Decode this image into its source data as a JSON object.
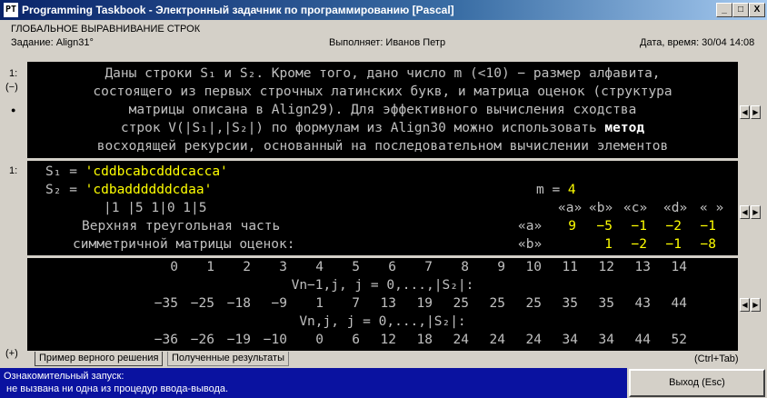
{
  "window": {
    "title": "Programming Taskbook - Электронный задачник по программированию [Pascal]",
    "app_icon": "PT",
    "buttons": [
      "_",
      "□",
      "X"
    ]
  },
  "header": {
    "group": "ГЛОБАЛЬНОЕ ВЫРАВНИВАНИЕ СТРОК",
    "task": "Задание: Align31°",
    "performer": "Выполняет: Иванов Петр",
    "datetime": "Дата, время: 30/04 14:08"
  },
  "task_panel": {
    "side_number": "1:",
    "side_minus": "(−)",
    "lines": [
      "Даны строки S₁ и S₂. Кроме того, дано число m (<10) − размер алфавита,",
      "состоящего из первых строчных латинских букв, и матрица оценок (структура",
      "матрицы описана в Align29). Для эффективного вычисления сходства",
      "строк V(|S₁|,|S₂|) по формулам из Align30 можно использовать ",
      "восходящей рекурсии, основанный на последовательном вычислении элементов"
    ],
    "bold_phrase_1": "метод",
    "bold_phrase_2": "восходящей рекурсии"
  },
  "input_panel": {
    "side_number": "1:",
    "s1_label": "S₁ = ",
    "s1_value": "'cddbcabcdddcacca'",
    "s2_label": "S₂ = ",
    "s2_value": "'cdbaddddddcdaa'",
    "m_label": "m = ",
    "m_value": "4",
    "separator_row": "|1   |5  1|0  1|5",
    "alphabet_header": [
      "«a»",
      "«b»",
      "«c»",
      "«d»",
      "« »"
    ],
    "matrix_label_1": "Верхняя треугольная часть",
    "matrix_label_2": "симметричной матрицы оценок:",
    "matrix_rows": [
      {
        "label": "«a»",
        "values": [
          "9",
          "−5",
          "−1",
          "−2",
          "−1"
        ]
      },
      {
        "label": "«b»",
        "values": [
          "",
          "1",
          "−2",
          "−1",
          "−8"
        ]
      }
    ]
  },
  "output_panel": {
    "index_row": [
      "0",
      "1",
      "2",
      "3",
      "4",
      "5",
      "6",
      "7",
      "8",
      "9",
      "10",
      "11",
      "12",
      "13",
      "14"
    ],
    "caption_1": "Vn−1,j, j = 0,...,|S₂|:",
    "row_1": [
      "−35",
      "−25",
      "−18",
      "−9",
      "1",
      "7",
      "13",
      "19",
      "25",
      "25",
      "25",
      "35",
      "35",
      "43",
      "44"
    ],
    "caption_2": "Vn,j, j = 0,...,|S₂|:",
    "row_2": [
      "−36",
      "−26",
      "−19",
      "−10",
      "0",
      "6",
      "12",
      "18",
      "24",
      "24",
      "24",
      "34",
      "34",
      "44",
      "52"
    ]
  },
  "side_markers": {
    "plus": "(+)",
    "dot": "●"
  },
  "tabs": {
    "correct": "Пример верного решения",
    "results": "Полученные результаты",
    "shortcut": "(Ctrl+Tab)"
  },
  "status": {
    "line1": "Ознакомительный запуск:",
    "line2": " не вызвана ни одна из процедур ввода-вывода."
  },
  "exit_button": "Выход (Esc)",
  "colors": {
    "panel_bg": "#000000",
    "text": "#c0c0c0",
    "highlight": "#ffff00",
    "status_bg": "#0a12a0"
  }
}
